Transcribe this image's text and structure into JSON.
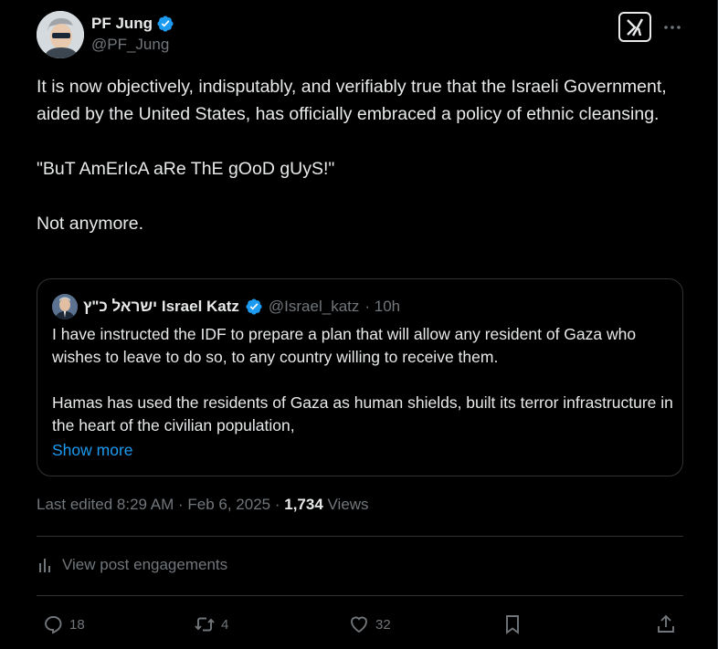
{
  "author": {
    "name": "PF Jung",
    "handle": "@PF_Jung"
  },
  "post": {
    "paragraphs": [
      "It is now objectively, indisputably, and verifiably true that the Israeli Government, aided by the United States, has officially embraced a policy of ethnic cleansing.",
      "\"BuT AmErIcA aRe ThE gOoD gUyS!\"",
      "Not anymore."
    ]
  },
  "quote": {
    "name": "ישראל כ\"ץ Israel Katz",
    "handle": "@Israel_katz",
    "time": "· 10h",
    "paragraphs": [
      "I have instructed the IDF to prepare a plan that will allow any resident of Gaza who wishes to leave to do so, to any country willing to receive them.",
      "Hamas has used the residents of Gaza as human shields, built its terror infrastructure in the heart of the civilian population,"
    ],
    "show_more": "Show more"
  },
  "meta": {
    "edited": "Last edited 8:29 AM · Feb 6, 2025 · ",
    "views_count": "1,734",
    "views_label": " Views"
  },
  "engagements_label": "View post engagements",
  "actions": {
    "replies": "18",
    "reposts": "4",
    "likes": "32"
  },
  "colors": {
    "background": "#000000",
    "text": "#e7e9ea",
    "muted": "#71767b",
    "accent": "#1d9bf0",
    "border": "#2f3336"
  },
  "icons": [
    "verified-badge-icon",
    "grok-icon",
    "more-icon",
    "analytics-icon",
    "reply-icon",
    "repost-icon",
    "like-icon",
    "bookmark-icon",
    "share-icon"
  ]
}
